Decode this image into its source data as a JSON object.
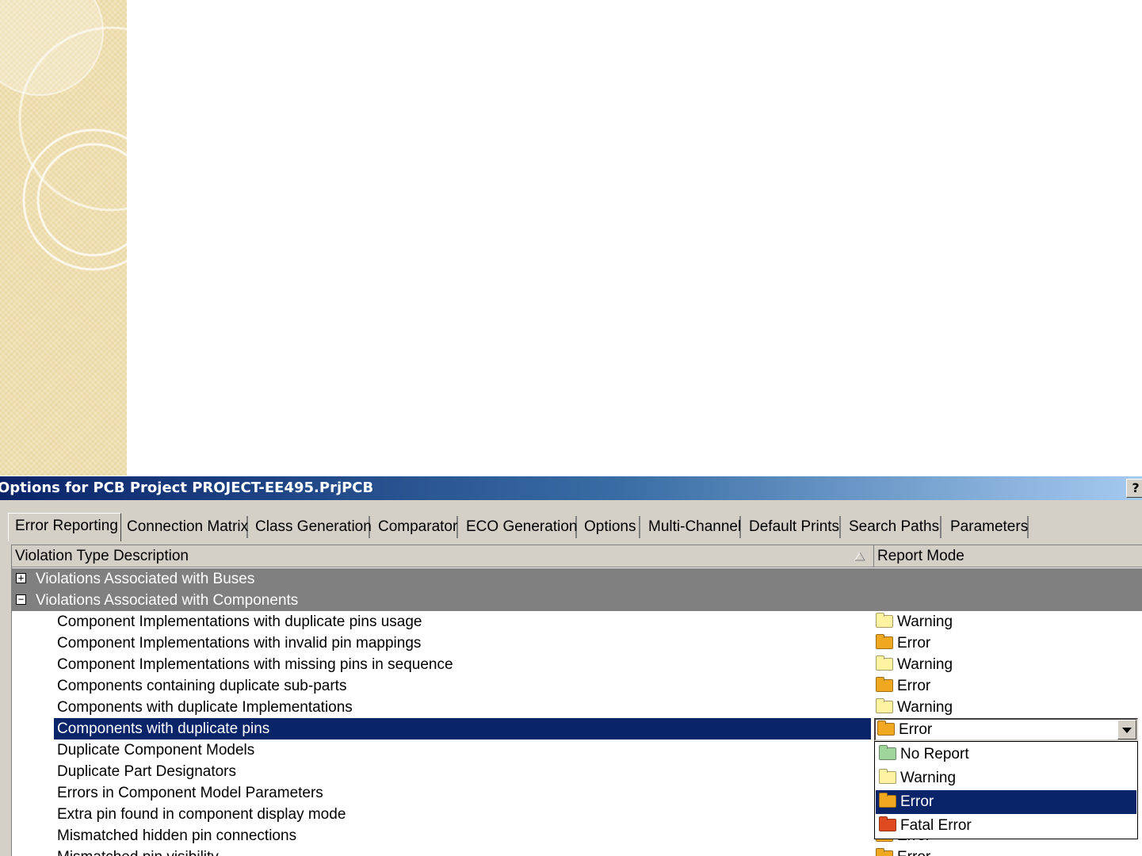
{
  "dialog": {
    "title": "Options for PCB Project PROJECT-EE495.PrjPCB",
    "help_label": "?"
  },
  "tabs": [
    {
      "label": "Error Reporting",
      "active": true
    },
    {
      "label": "Connection Matrix"
    },
    {
      "label": "Class Generation"
    },
    {
      "label": "Comparator"
    },
    {
      "label": "ECO Generation"
    },
    {
      "label": "Options"
    },
    {
      "label": "Multi-Channel"
    },
    {
      "label": "Default Prints"
    },
    {
      "label": "Search Paths"
    },
    {
      "label": "Parameters"
    }
  ],
  "grid": {
    "columns": [
      "Violation Type Description",
      "Report Mode"
    ],
    "sort_icon": "sort-ascending-icon",
    "groups": [
      {
        "label": "Violations Associated with Buses",
        "expander": "+"
      },
      {
        "label": "Violations Associated with Components",
        "expander": "−"
      }
    ],
    "rows": [
      {
        "label": "Component Implementations with duplicate pins usage",
        "mode": "Warning"
      },
      {
        "label": "Component Implementations with invalid pin mappings",
        "mode": "Error"
      },
      {
        "label": "Component Implementations with missing pins in sequence",
        "mode": "Warning"
      },
      {
        "label": "Components containing duplicate sub-parts",
        "mode": "Error"
      },
      {
        "label": "Components with duplicate Implementations",
        "mode": "Warning"
      },
      {
        "label": "Components with duplicate pins",
        "mode": "Error",
        "selected": true
      },
      {
        "label": "Duplicate Component Models",
        "mode": ""
      },
      {
        "label": "Duplicate Part Designators",
        "mode": ""
      },
      {
        "label": "Errors in Component Model Parameters",
        "mode": ""
      },
      {
        "label": "Extra pin found in component display mode",
        "mode": ""
      },
      {
        "label": "Mismatched hidden pin connections",
        "mode": "Error"
      },
      {
        "label": "Mismatched pin visibility",
        "mode": "Error"
      }
    ]
  },
  "combo": {
    "value": "Error",
    "options": [
      "No Report",
      "Warning",
      "Error",
      "Fatal Error"
    ],
    "selected_option": "Error"
  },
  "colors": {
    "selection": "#0a246a",
    "group_row": "#808080",
    "dialog_face": "#d4d0c8",
    "warning_folder": "#fff2a0",
    "error_folder": "#f0a820",
    "fatal_folder": "#e04a20",
    "no_report_folder": "#9fd49a"
  }
}
